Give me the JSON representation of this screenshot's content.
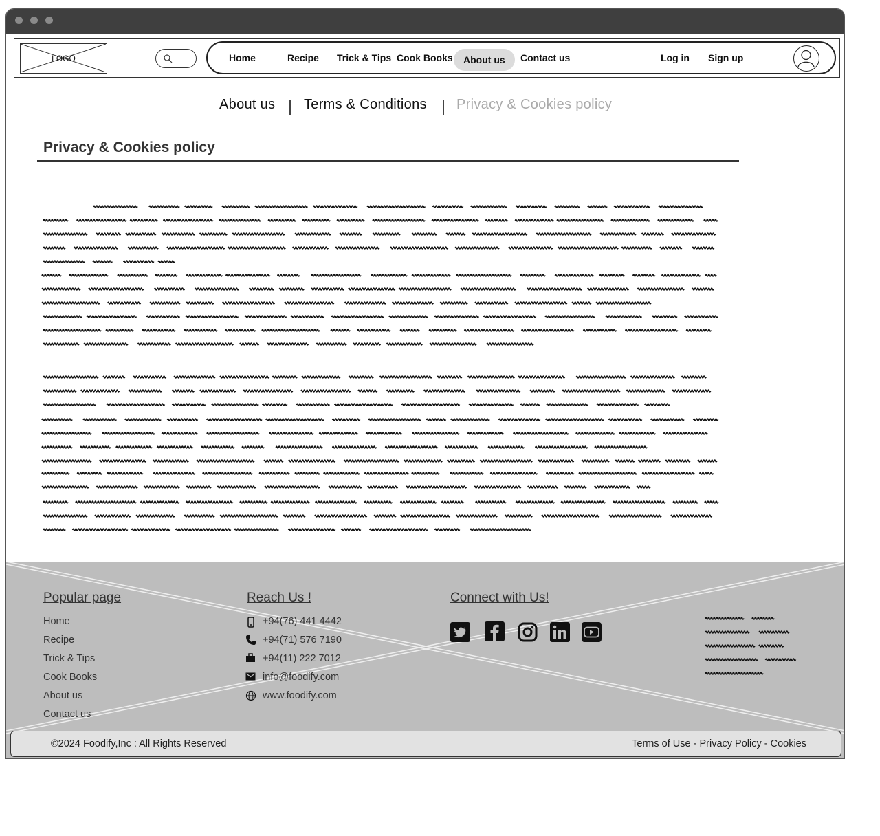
{
  "header": {
    "logo_text": "LOGO",
    "nav": [
      "Home",
      "Recipe",
      "Trick & Tips",
      "Cook Books",
      "About us",
      "Contact us"
    ],
    "active_nav": "About us",
    "login": "Log in",
    "signup": "Sign up"
  },
  "subnav": {
    "about": "About us",
    "terms": "Terms & Conditions",
    "privacy": "Privacy & Cookies policy",
    "active": "Privacy & Cookies policy",
    "inactive_color": "#aaaaaa"
  },
  "page_title": "Privacy & Cookies policy",
  "footer": {
    "popular_heading": "Popular page",
    "popular_links": [
      "Home",
      "Recipe",
      "Trick & Tips",
      "Cook Books",
      "About us",
      "Contact us"
    ],
    "reach_heading": "Reach Us !",
    "contacts": [
      {
        "icon": "mobile-phone-icon",
        "text": "+94(76) 441 4442"
      },
      {
        "icon": "phone-icon",
        "text": "+94(71) 576 7190"
      },
      {
        "icon": "briefcase-icon",
        "text": "+94(11) 222 7012"
      },
      {
        "icon": "mail-icon",
        "text": "info@foodify.com"
      },
      {
        "icon": "globe-icon",
        "text": "www.foodify.com"
      }
    ],
    "connect_heading": "Connect with Us!",
    "social": [
      "twitter-icon",
      "facebook-icon",
      "instagram-icon",
      "linkedin-icon",
      "youtube-icon"
    ],
    "copyright": "©2024  Foodify,Inc : All Rights Reserved",
    "legal": {
      "terms": "Terms of Use",
      "privacy": "Privacy Policy",
      "cookies": "Cookies",
      "separator": " - "
    }
  }
}
